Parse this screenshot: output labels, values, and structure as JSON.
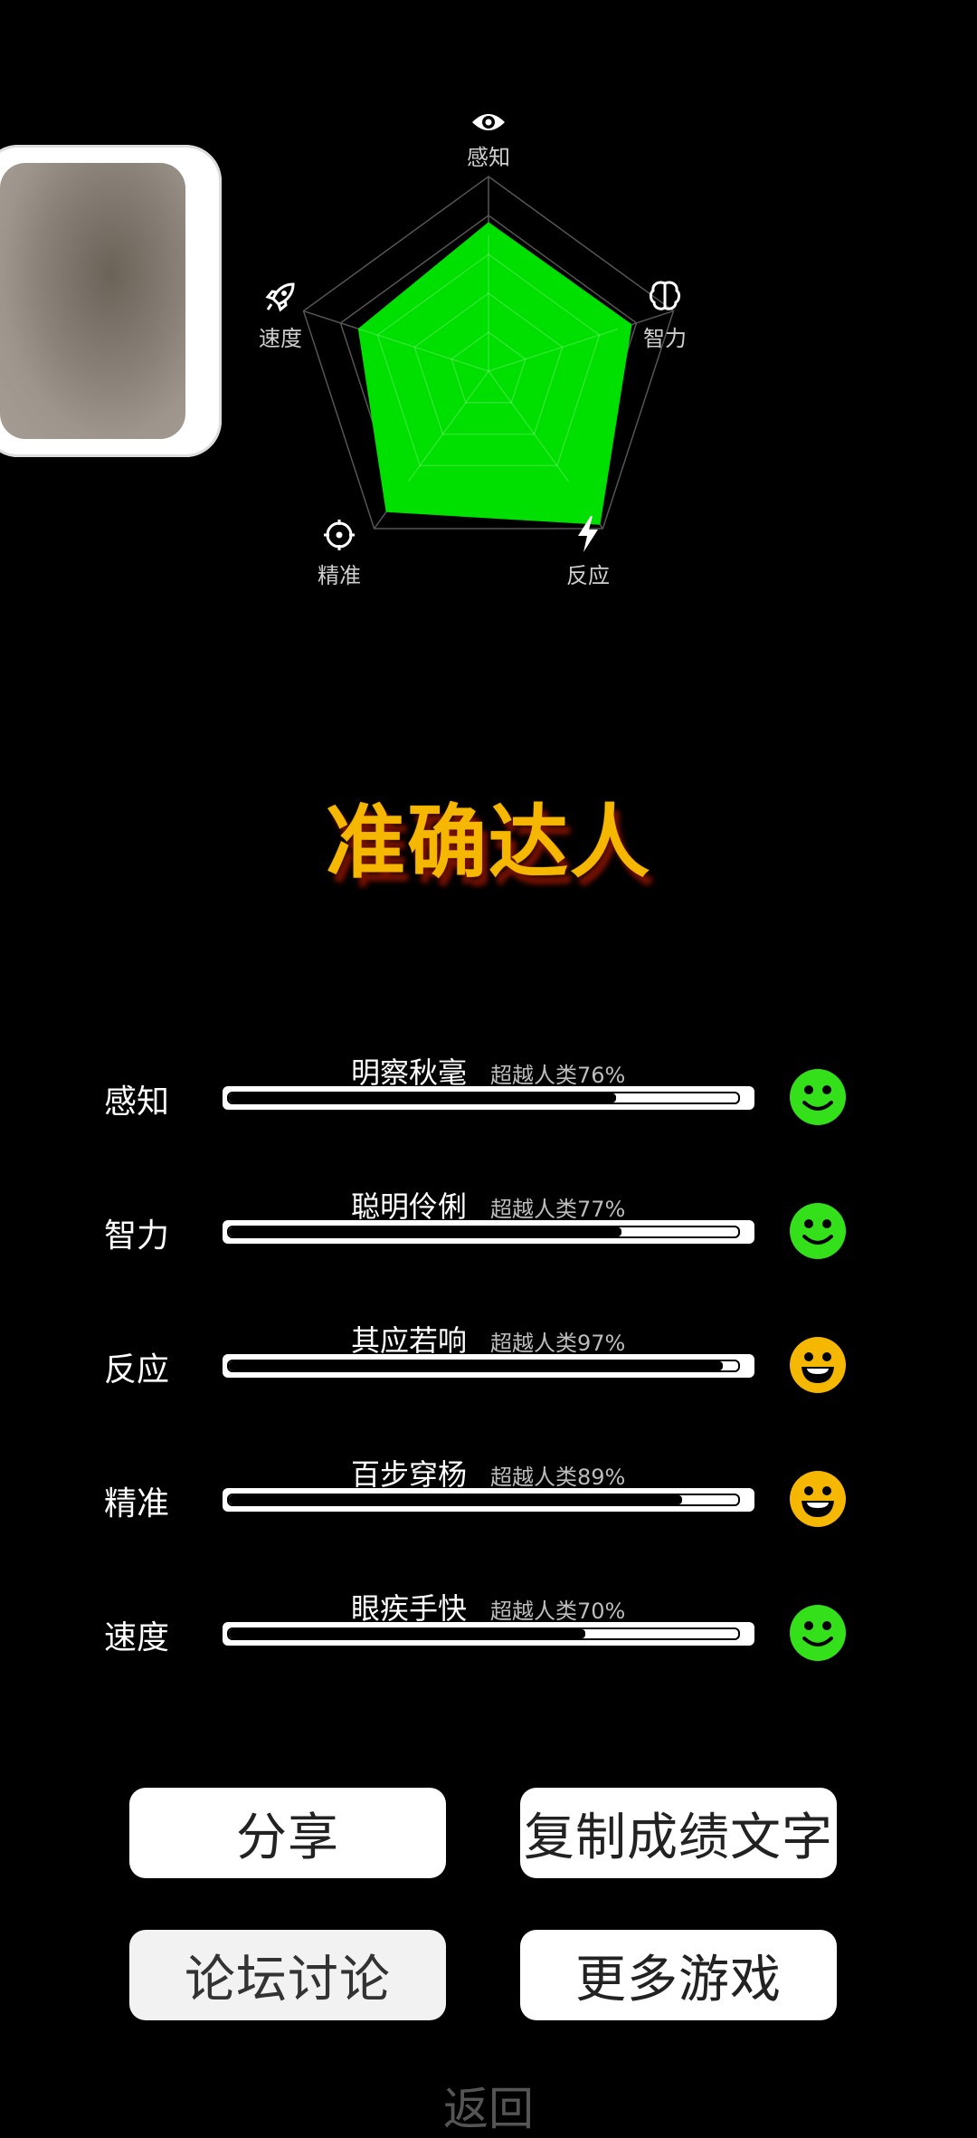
{
  "radar": {
    "labels": [
      "感知",
      "智力",
      "反应",
      "精准",
      "速度"
    ],
    "values": [
      0.76,
      0.77,
      0.97,
      0.89,
      0.7
    ],
    "icons": [
      "eye-icon",
      "brain-icon",
      "lightning-icon",
      "target-icon",
      "rocket-icon"
    ],
    "fill_color": "#00e000"
  },
  "title": "准确达人",
  "scores": [
    {
      "label": "感知",
      "desc": "明察秋毫",
      "pct_text": "超越人类76%",
      "value": 0.76,
      "face": "smile",
      "face_color": "#33e01a"
    },
    {
      "label": "智力",
      "desc": "聪明伶俐",
      "pct_text": "超越人类77%",
      "value": 0.77,
      "face": "smile",
      "face_color": "#33e01a"
    },
    {
      "label": "反应",
      "desc": "其应若响",
      "pct_text": "超越人类97%",
      "value": 0.97,
      "face": "grin",
      "face_color": "#f5b700"
    },
    {
      "label": "精准",
      "desc": "百步穿杨",
      "pct_text": "超越人类89%",
      "value": 0.89,
      "face": "grin",
      "face_color": "#f5b700"
    },
    {
      "label": "速度",
      "desc": "眼疾手快",
      "pct_text": "超越人类70%",
      "value": 0.7,
      "face": "smile",
      "face_color": "#33e01a"
    }
  ],
  "buttons": {
    "share": "分享",
    "copy": "复制成绩文字",
    "forum": "论坛讨论",
    "more_games": "更多游戏"
  },
  "back": "返回"
}
